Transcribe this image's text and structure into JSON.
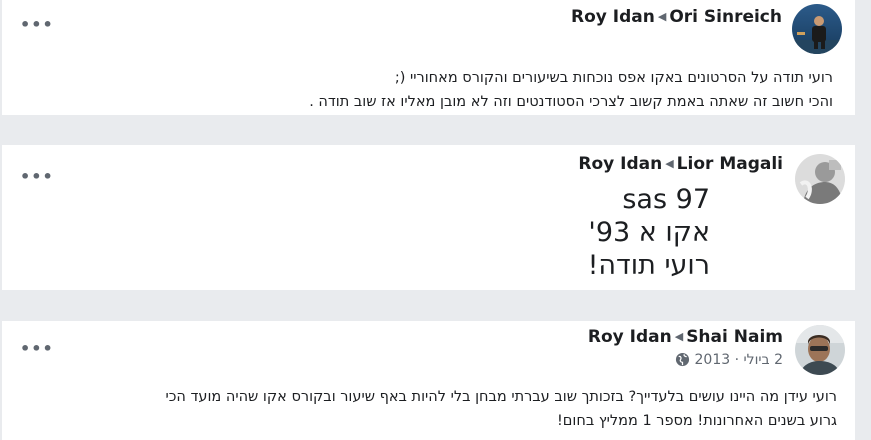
{
  "posts": [
    {
      "menu": "•••",
      "author": "Roy Idan",
      "recipient": "Ori Sinreich",
      "lines": [
        "רועי תודה על הסרטונים באקו אפס נוכחות בשיעורים והקורס מאחוריי (;",
        "והכי חשוב זה שאתה באמת קשוב לצרכי הסטודנטים וזה לא מובן מאליו אז שוב תודה ."
      ]
    },
    {
      "menu": "•••",
      "author": "Roy Idan",
      "recipient": "Lior Magali",
      "lines": [
        "97 sas",
        "אקו א 93'",
        "רועי תודה!"
      ]
    },
    {
      "menu": "•••",
      "author": "Roy Idan",
      "recipient": "Shai Naim",
      "date": "2 ביולי · 2013",
      "lines": [
        "רועי עידן מה היינו עושים בלעדייך? בזכותך שוב עברתי מבחן בלי להיות באף שיעור ובקורס אקו שהיה מועד הכי",
        "גרוע בשנים האחרונות! מספר 1 ממליץ בחום!"
      ]
    }
  ],
  "icons": {
    "arrow": "caret-left-icon",
    "privacy": "globe-icon"
  }
}
